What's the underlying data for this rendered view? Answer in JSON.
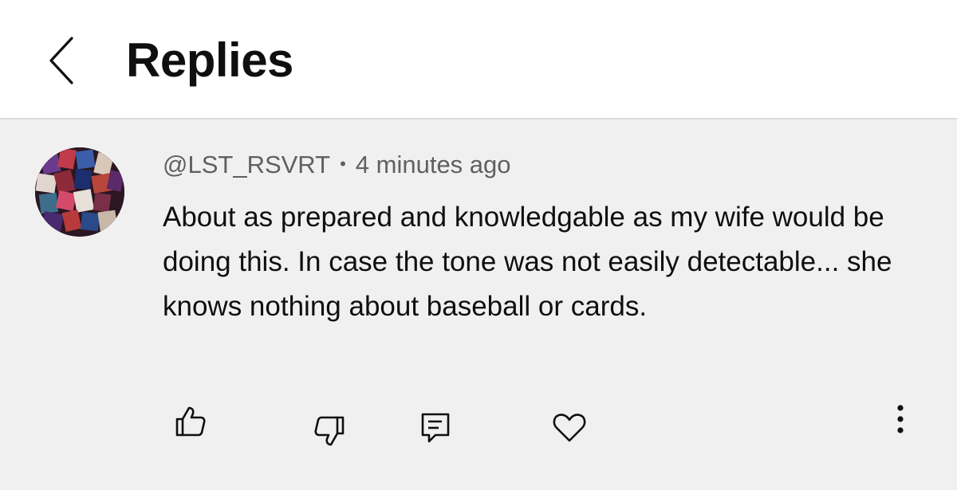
{
  "header": {
    "title": "Replies",
    "back_icon": "chevron-left-icon"
  },
  "comment": {
    "author": "@LST_RSVRT",
    "separator": "•",
    "time": "4 minutes ago",
    "text": "About as prepared and knowledgable as my wife would be doing this. In case the tone was not easily detectable... she knows nothing about baseball or cards.",
    "avatar": "collage-avatar",
    "actions": {
      "like_icon": "thumbs-up-icon",
      "dislike_icon": "thumbs-down-icon",
      "reply_icon": "reply-comment-icon",
      "heart_icon": "heart-icon",
      "more_icon": "more-vertical-icon"
    }
  },
  "colors": {
    "header_bg": "#ffffff",
    "body_bg": "#f0f0f0",
    "text": "#0f0f0f",
    "meta_text": "#606060"
  }
}
